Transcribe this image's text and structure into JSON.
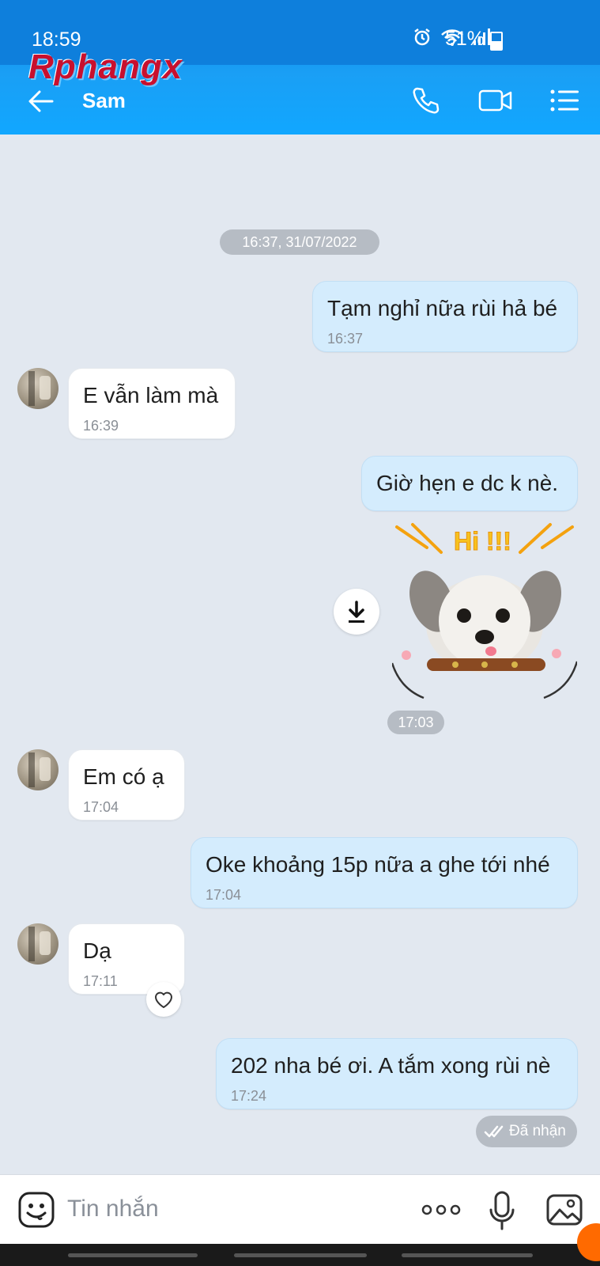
{
  "status_bar": {
    "time": "18:59",
    "battery": "51%"
  },
  "watermark": "Rphangx",
  "header": {
    "contact_name": "Sam"
  },
  "chat": {
    "date_divider": "16:37, 31/07/2022",
    "messages": [
      {
        "text": "Tạm nghỉ nữa rùi hả bé",
        "time": "16:37"
      },
      {
        "text": "E vẫn làm mà",
        "time": "16:39"
      },
      {
        "text": "Giờ hẹn e dc k nè.",
        "time": ""
      },
      {
        "text": "",
        "time": "17:03"
      },
      {
        "text": "Em có ạ",
        "time": "17:04"
      },
      {
        "text": "Oke khoảng 15p nữa a ghe tới nhé",
        "time": "17:04"
      },
      {
        "text": "Dạ",
        "time": "17:11"
      },
      {
        "text": "202 nha bé ơi. A tắm xong rùi nè",
        "time": "17:24"
      }
    ],
    "sticker_text": "Hi !!!",
    "received_status": "Đã nhận"
  },
  "composer": {
    "placeholder": "Tin nhắn"
  }
}
